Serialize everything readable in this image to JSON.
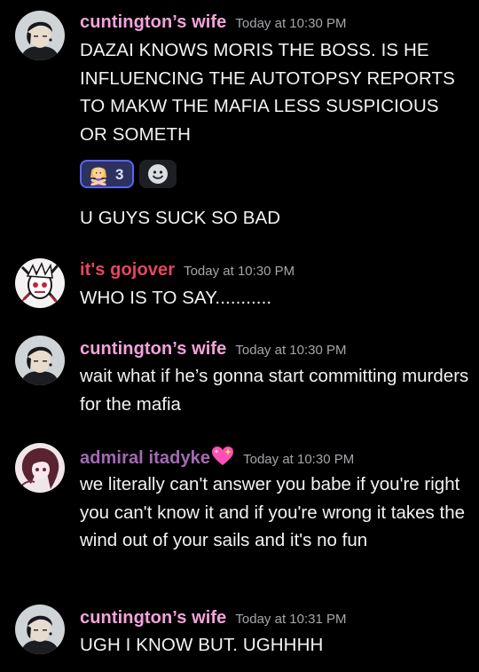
{
  "colors": {
    "background": "#000000",
    "author_pink": "#f4a3dc",
    "author_red": "#e8455f",
    "author_purple": "#a569b5",
    "timestamp": "#a3a6aa",
    "reaction_active_bg": "#2d3160",
    "reaction_active_border": "#5865f2"
  },
  "messages": [
    {
      "author": "cuntington’s wife",
      "timestamp": "Today at 10:30 PM",
      "lines": [
        "DAZAI KNOWS MORIS THE BOSS. IS HE INFLUENCING THE AUTOTOPSY REPORTS TO MAKW THE MAFIA LESS SUSPICIOUS OR SOMETH",
        "U GUYS SUCK SO BAD"
      ],
      "reactions": [
        {
          "emoji": "person-gesturing-no-emoji",
          "count": "3",
          "active": true
        },
        {
          "emoji": "add-reaction-icon",
          "count": "",
          "active": false
        }
      ]
    },
    {
      "author": "it's gojover",
      "timestamp": "Today at 10:30 PM",
      "lines": [
        "WHO IS TO SAY..........."
      ]
    },
    {
      "author": "cuntington’s wife",
      "timestamp": "Today at 10:30 PM",
      "lines": [
        "wait what if he’s gonna start committing murders for the mafia"
      ]
    },
    {
      "author": "admiral itadyke",
      "author_emoji": "sparkling-heart-icon",
      "timestamp": "Today at 10:30 PM",
      "lines": [
        "we literally can't answer you babe if you're right you can't know it and if you're wrong it takes the wind out of your sails and it's no fun"
      ]
    },
    {
      "author": "cuntington’s wife",
      "timestamp": "Today at 10:31 PM",
      "lines": [
        "UGH I KNOW BUT. UGHHHH"
      ]
    }
  ]
}
